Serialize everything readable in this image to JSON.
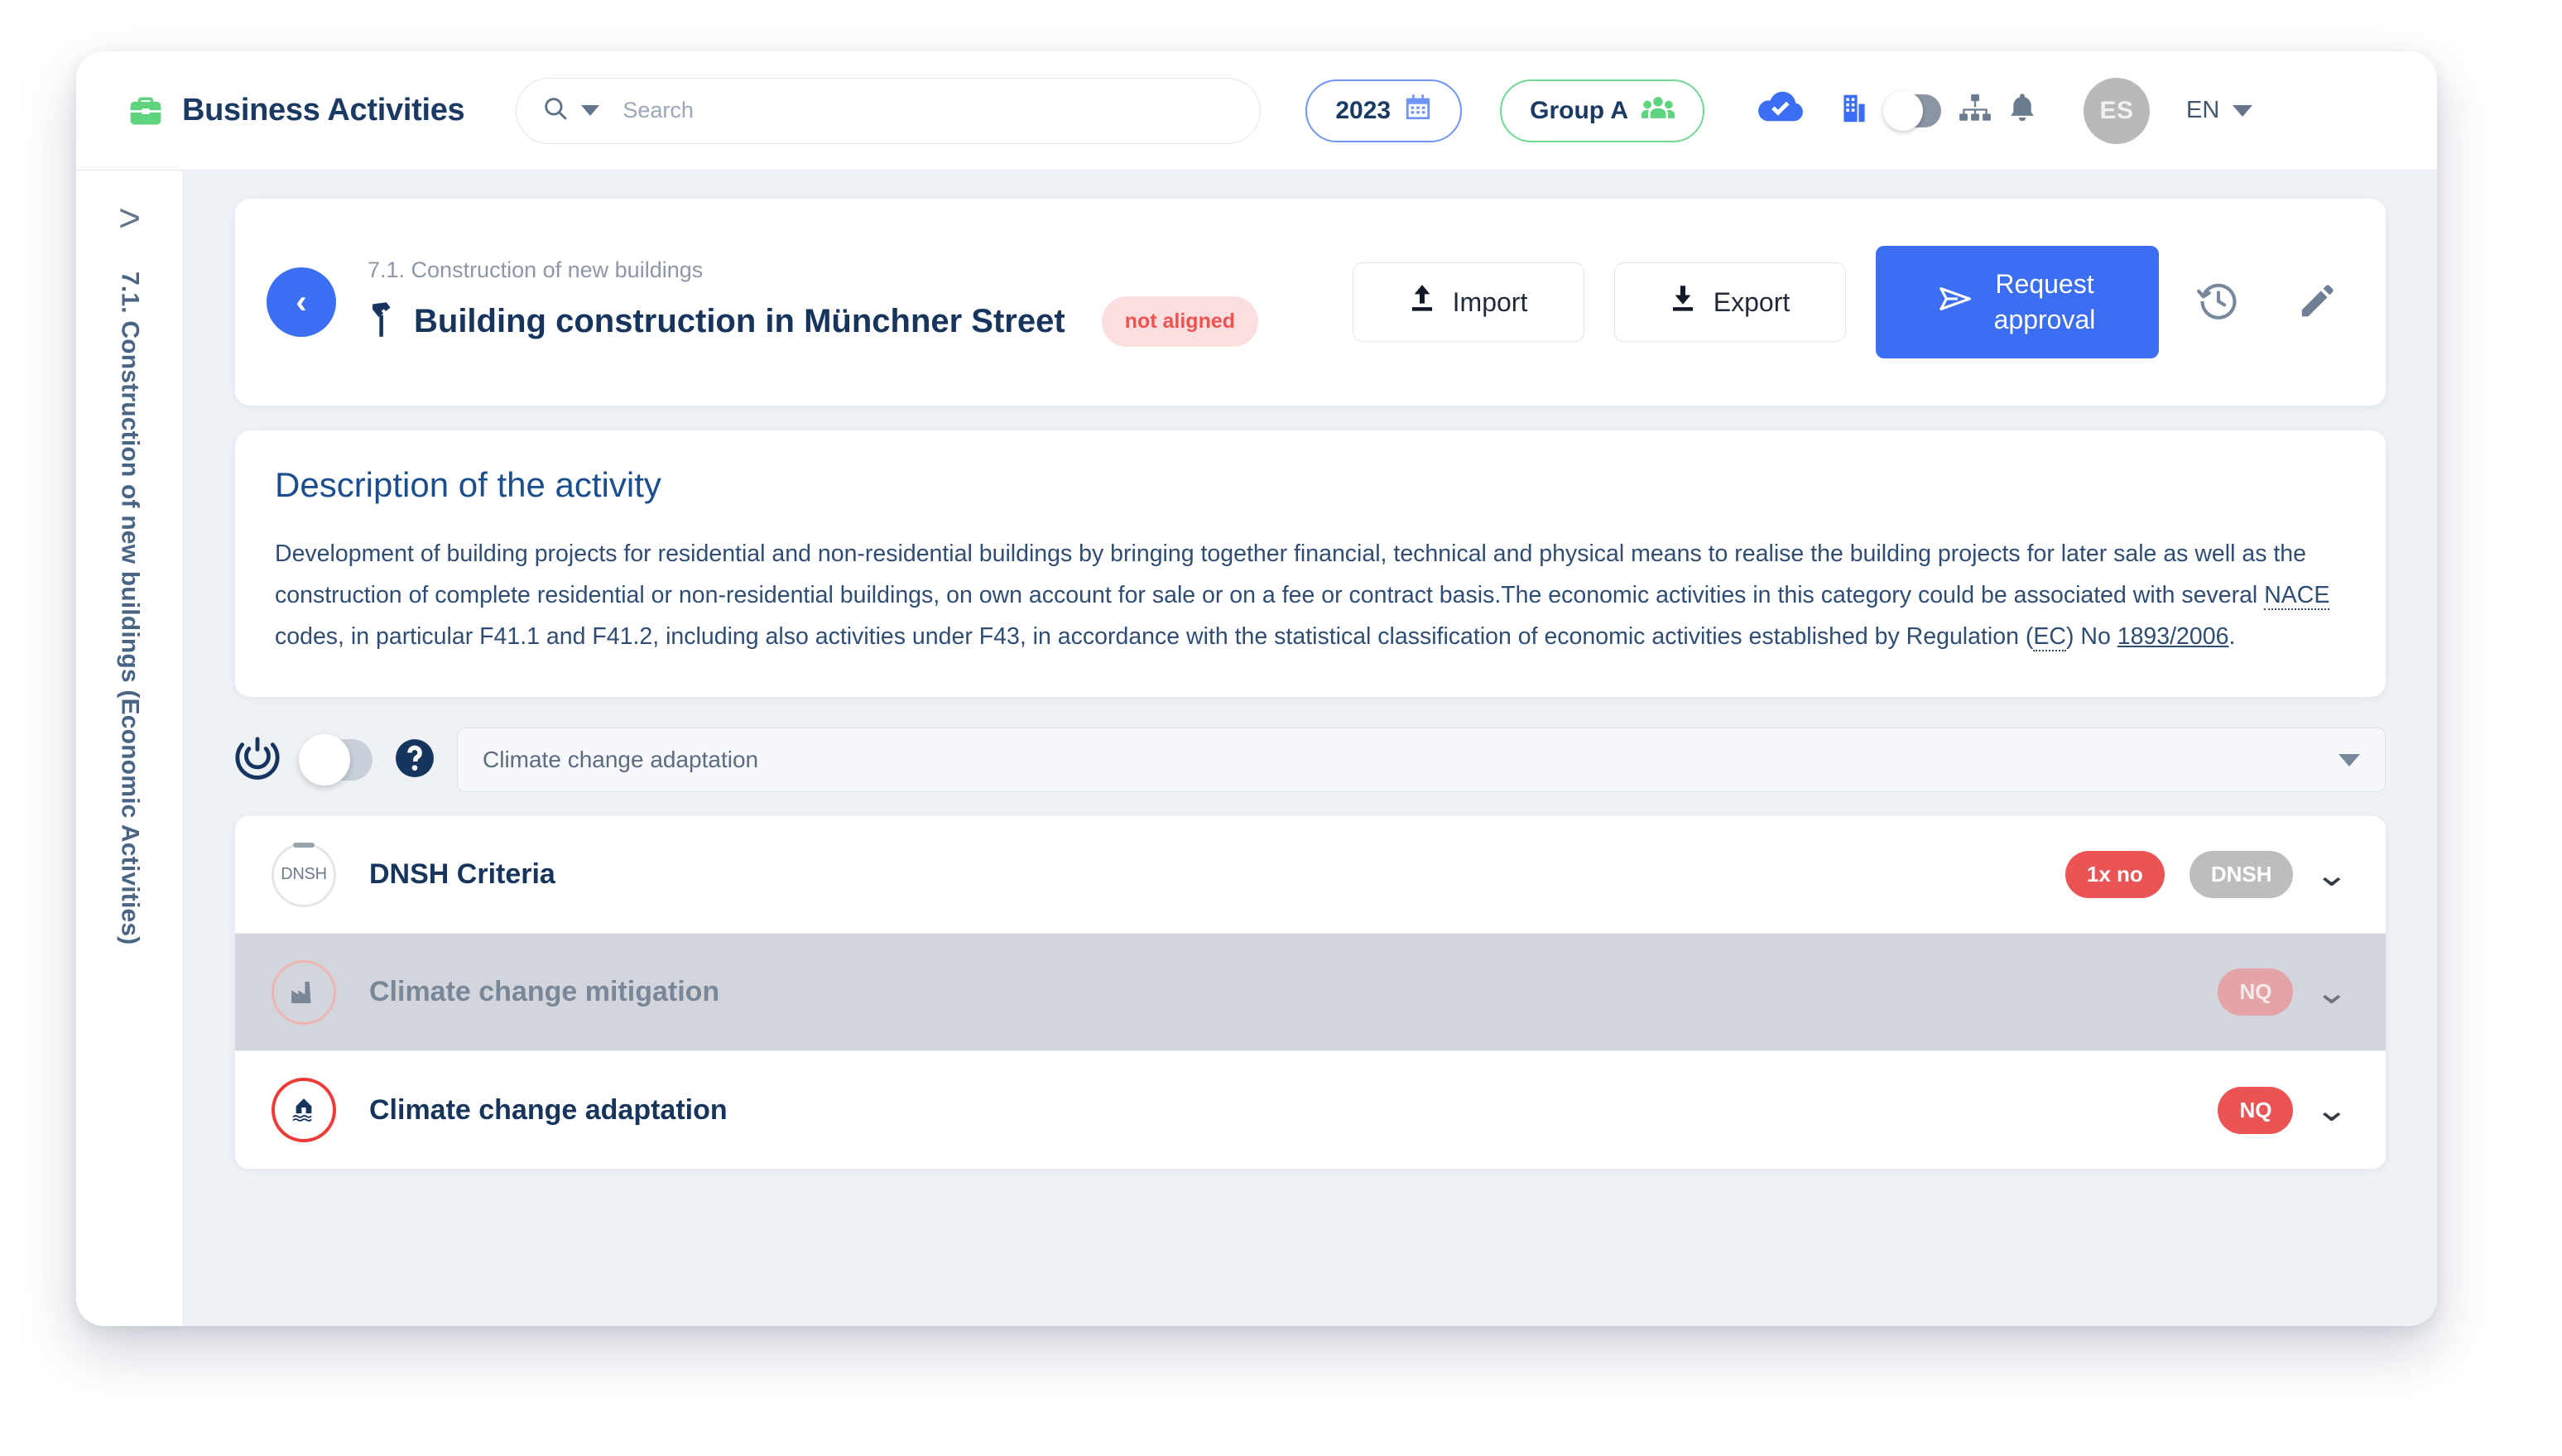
{
  "header": {
    "brand_title": "Business Activities",
    "brand_icon": "briefcase-icon",
    "search_placeholder": "Search",
    "search_value": "",
    "year_pill": "2023",
    "group_pill": "Group A",
    "avatar_initials": "ES",
    "language": "EN",
    "icons": [
      "cloud-check-icon",
      "building-icon",
      "company-toggle",
      "org-chart-icon",
      "bell-icon"
    ],
    "accent_blue": "#3b6ef2",
    "accent_green": "#5ed47e"
  },
  "rail": {
    "expand_label": ">",
    "vertical_title": "7.1. Construction of new buildings (Economic Activities)"
  },
  "activity": {
    "back_label": "‹",
    "breadcrumb": "7.1. Construction of new buildings",
    "title": "Building construction in Münchner Street",
    "title_icon": "hammer-icon",
    "status_badge": "not aligned",
    "status_badge_color": "#ef5350",
    "import_label": "Import",
    "export_label": "Export",
    "request_approval_line1": "Request",
    "request_approval_line2": "approval",
    "history_icon": "history-icon",
    "edit_icon": "pencil-icon"
  },
  "description": {
    "title": "Description of the activity",
    "p1": "Development of building projects for residential and non-residential buildings by bringing together financial, technical and physical means to realise the building projects for later sale as well as the construction of complete residential or non-residential buildings, on own account for sale or on a fee or contract basis.The economic activities in this category could be associated with several ",
    "abbr1": "NACE",
    "p2": " codes, in particular F41.1 and F41.2, including also activities under F43, in accordance with the statistical classification of economic activities established by Regulation (",
    "abbr2": "EC",
    "p3": ") No ",
    "link": "1893/2006",
    "p4": "."
  },
  "objective": {
    "power_icon": "power-target-icon",
    "toggle_state": "off",
    "help_icon": "help-icon",
    "selected": "Climate change adaptation"
  },
  "criteria": [
    {
      "icon": "dnsh-circle-icon",
      "icon_label": "DNSH",
      "label": "DNSH Criteria",
      "badges": [
        {
          "text": "1x no",
          "style": "red"
        },
        {
          "text": "DNSH",
          "style": "gray"
        }
      ],
      "chevron": "chevron-down-icon",
      "disabled": false
    },
    {
      "icon": "factory-icon",
      "icon_label": "",
      "label": "Climate change mitigation",
      "badges": [
        {
          "text": "NQ",
          "style": "red-muted"
        }
      ],
      "chevron": "chevron-down-icon",
      "disabled": true
    },
    {
      "icon": "flood-house-icon",
      "icon_label": "",
      "label": "Climate change adaptation",
      "badges": [
        {
          "text": "NQ",
          "style": "red"
        }
      ],
      "chevron": "chevron-down-icon",
      "disabled": false
    }
  ]
}
